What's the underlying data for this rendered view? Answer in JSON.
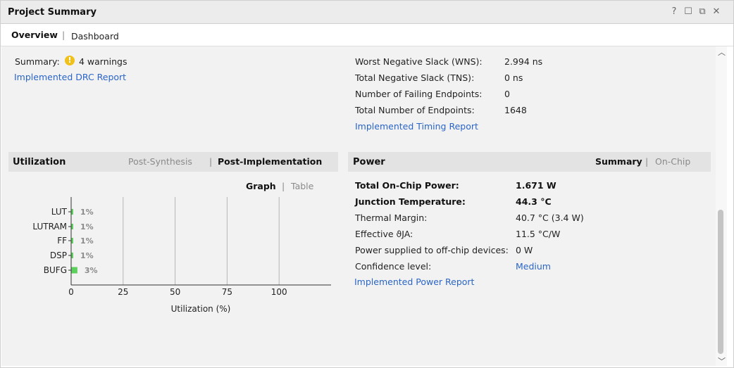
{
  "window": {
    "title": "Project Summary",
    "controls": [
      "?",
      "☐",
      "⧉",
      "✕"
    ]
  },
  "tabs": [
    {
      "label": "Overview",
      "active": true
    },
    {
      "label": "Dashboard",
      "active": false
    }
  ],
  "drc": {
    "summary_label": "Summary:",
    "warnings_text": "4 warnings",
    "report_link": "Implemented DRC Report"
  },
  "timing": {
    "rows": [
      {
        "label": "Worst Negative Slack (WNS):",
        "value": "2.994 ns"
      },
      {
        "label": "Total Negative Slack (TNS):",
        "value": "0 ns"
      },
      {
        "label": "Number of Failing Endpoints:",
        "value": "0"
      },
      {
        "label": "Total Number of Endpoints:",
        "value": "1648"
      }
    ],
    "report_link": "Implemented Timing Report"
  },
  "utilization": {
    "title": "Utilization",
    "tab_post_synth": "Post-Synthesis",
    "tab_post_impl": "Post-Implementation",
    "view_graph": "Graph",
    "view_table": "Table"
  },
  "power": {
    "title": "Power",
    "tab_summary": "Summary",
    "tab_onchip": "On-Chip",
    "rows": [
      {
        "label": "Total On-Chip Power:",
        "value": "1.671 W",
        "bold": true
      },
      {
        "label": "Junction Temperature:",
        "value": "44.3 °C",
        "bold": true
      },
      {
        "label": "Thermal Margin:",
        "value": "40.7 °C (3.4 W)"
      },
      {
        "label": "Effective ϑJA:",
        "value": "11.5 °C/W"
      },
      {
        "label": "Power supplied to off-chip devices:",
        "value": "0 W"
      },
      {
        "label": "Confidence level:",
        "value": "Medium",
        "link": true
      }
    ],
    "report_link": "Implemented Power Report"
  },
  "chart_data": {
    "type": "bar",
    "orientation": "horizontal",
    "categories": [
      "LUT",
      "LUTRAM",
      "FF",
      "DSP",
      "BUFG"
    ],
    "values": [
      1,
      1,
      1,
      1,
      3
    ],
    "value_labels": [
      "1%",
      "1%",
      "1%",
      "1%",
      "3%"
    ],
    "xlabel": "Utilization (%)",
    "xticks": [
      "0",
      "25",
      "50",
      "75",
      "100"
    ],
    "xlim": [
      0,
      125
    ],
    "grid": true,
    "bar_color": "#5dcf5d"
  }
}
